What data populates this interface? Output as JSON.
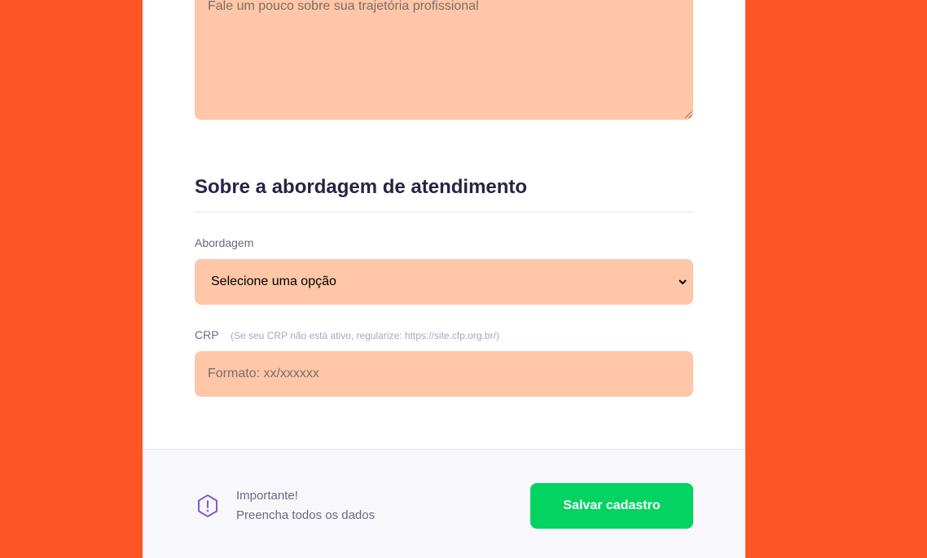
{
  "bio": {
    "placeholder": "Fale um pouco sobre sua trajetória profissional"
  },
  "section": {
    "title": "Sobre a abordagem de atendimento"
  },
  "abordagem": {
    "label": "Abordagem",
    "selected": "Selecione uma opção"
  },
  "crp": {
    "label": "CRP",
    "hint": "(Se seu CRP não está ativo, regularize: https://site.cfp.org.br/)",
    "placeholder": "Formato: xx/xxxxxx"
  },
  "footer": {
    "warning_title": "Importante!",
    "warning_text": "Preencha todos os dados",
    "save_label": "Salvar cadastro"
  },
  "colors": {
    "background": "#FF5426",
    "field": "#FFC6A8",
    "accent_green": "#04D361",
    "title": "#272444",
    "warning_icon": "#8257E5"
  },
  "icons": {
    "warning": "exclamation-hexagon-icon",
    "select": "chevron-down-icon"
  }
}
